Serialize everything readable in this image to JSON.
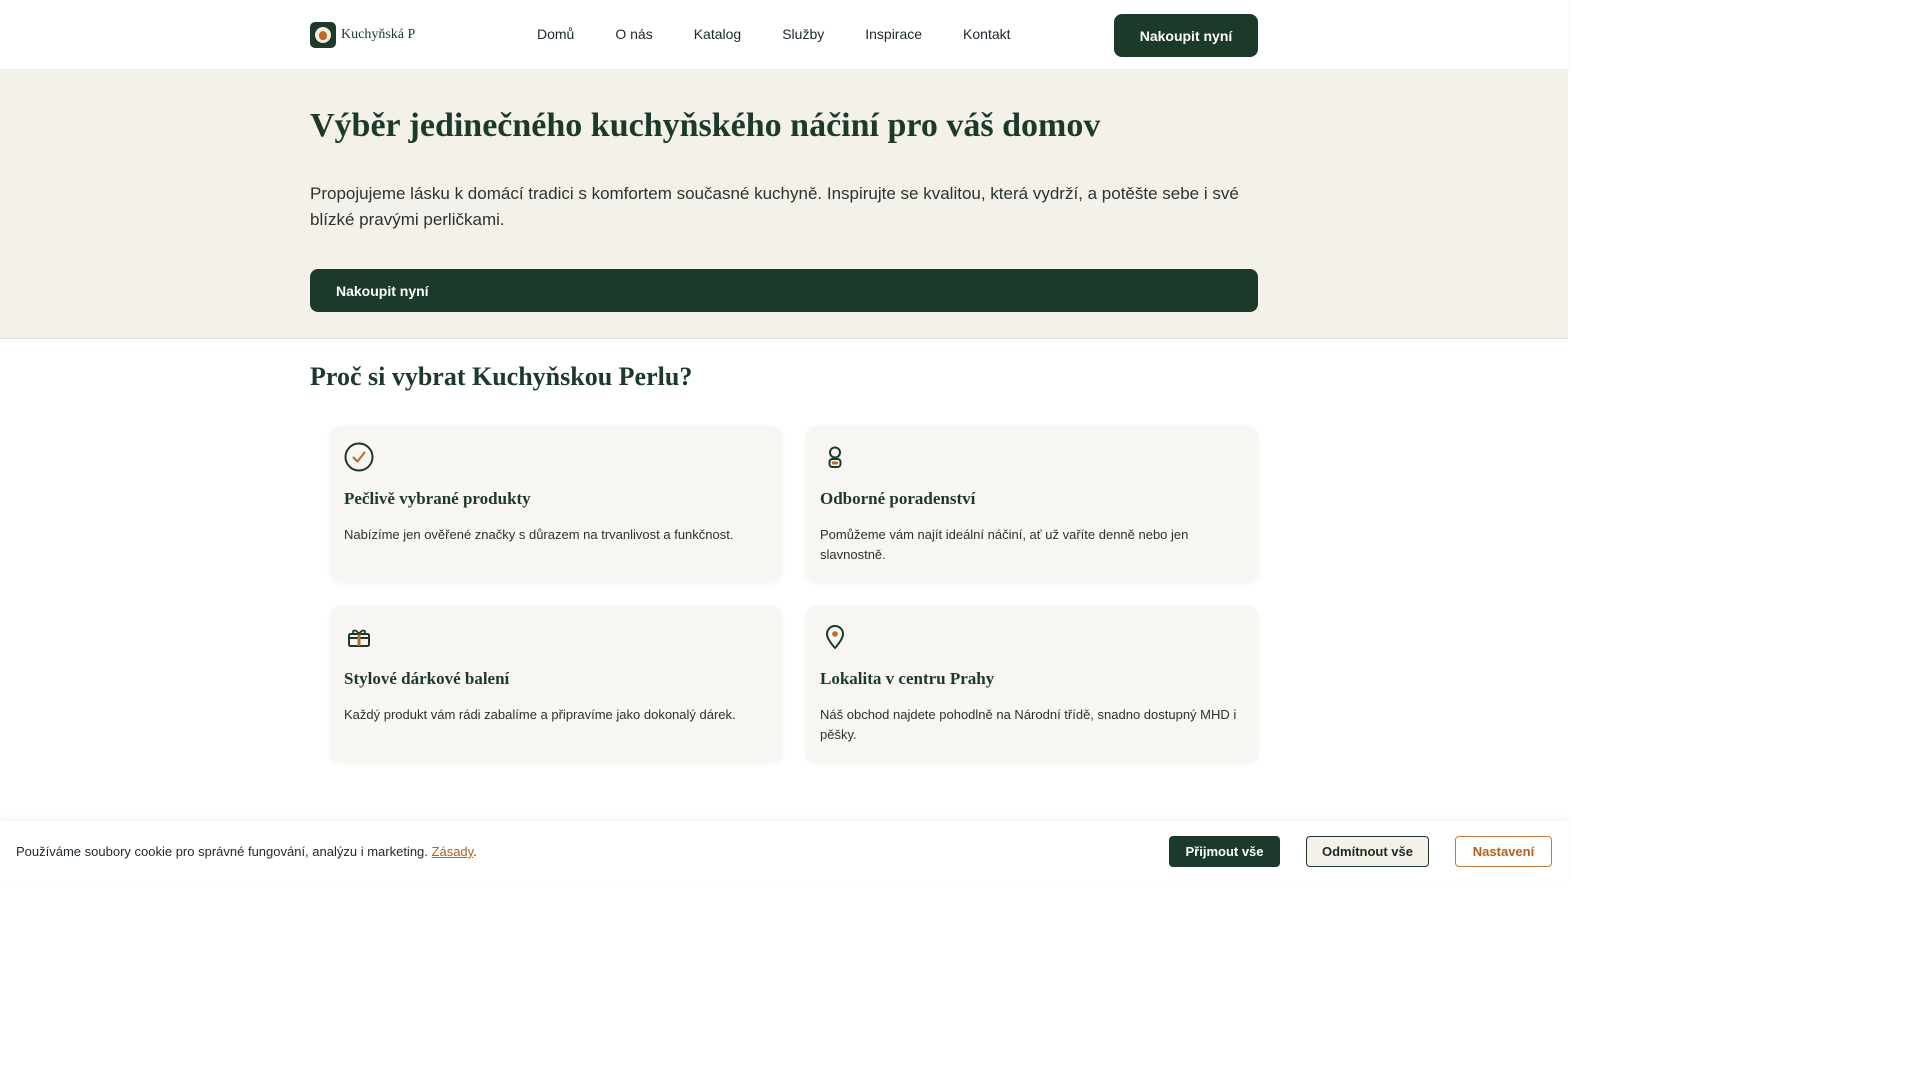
{
  "header": {
    "brand": "Kuchyňská Perla",
    "nav": [
      "Domů",
      "O nás",
      "Katalog",
      "Služby",
      "Inspirace",
      "Kontakt"
    ],
    "cta_label": "Nakoupit nyní"
  },
  "hero": {
    "title": "Výběr jedinečného kuchyňského náčiní pro váš domov",
    "text": "Propojujeme lásku k domácí tradici s komfortem současné kuchyně. Inspirujte se kvalitou, která vydrží, a potěšte sebe i své blízké pravými perličkami.",
    "cta_label": "Nakoupit nyní"
  },
  "why": {
    "title": "Proč si vybrat Kuchyňskou Perlu?",
    "cards": [
      {
        "icon": "check-circle-icon",
        "title": "Pečlivě vybrané produkty",
        "text": "Nabízíme jen ověřené značky s důrazem na trvanlivost a funkčnost."
      },
      {
        "icon": "advisor-icon",
        "title": "Odborné poradenství",
        "text": "Pomůžeme vám najít ideální náčiní, ať už vaříte denně nebo jen slavnostně."
      },
      {
        "icon": "gift-icon",
        "title": "Stylové dárkové balení",
        "text": "Každý produkt vám rádi zabalíme a připravíme jako dokonalý dárek."
      },
      {
        "icon": "location-pin-icon",
        "title": "Lokalita v centru Prahy",
        "text": "Náš obchod najdete pohodlně na Národní třídě, snadno dostupný MHD i pěšky."
      }
    ]
  },
  "cookie": {
    "text": "Používáme soubory cookie pro správné fungování, analýzu i marketing.",
    "link_label": "Zásady",
    "accept_label": "Přijmout vše",
    "decline_label": "Odmítnout vše",
    "settings_label": "Nastavení"
  },
  "colors": {
    "primary": "#1c3a2a",
    "accent": "#c06a1e",
    "hero_bg": "#f4f1eb"
  }
}
